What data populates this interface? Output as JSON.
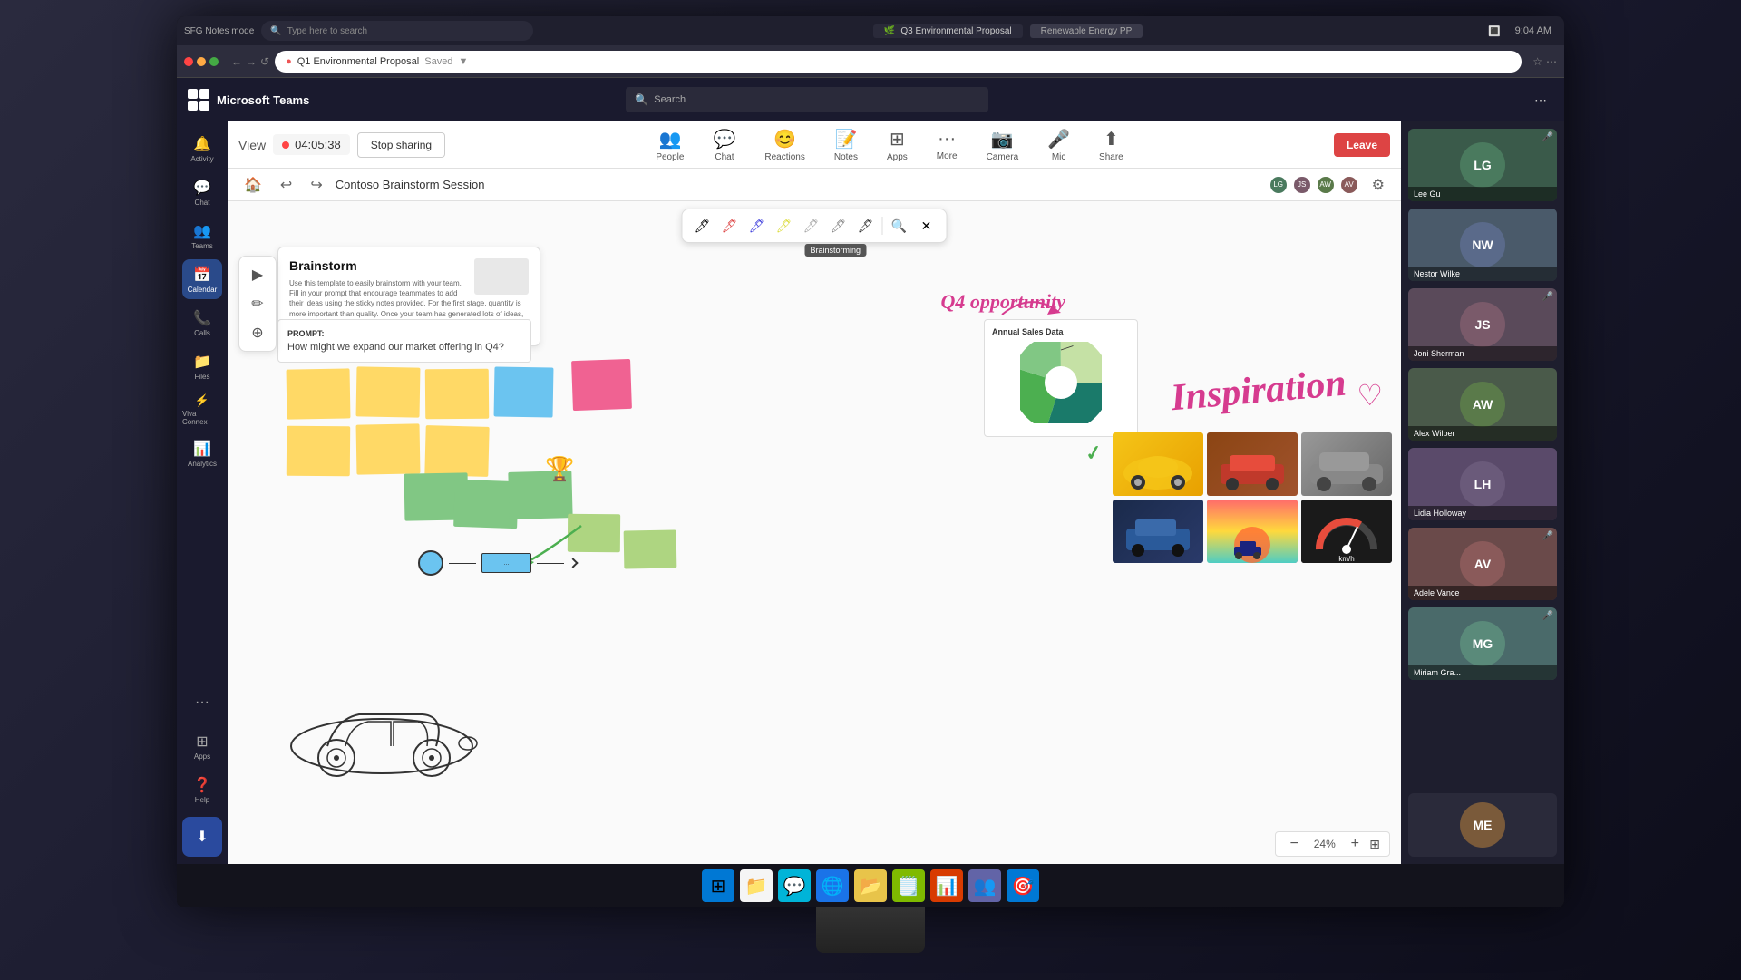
{
  "window": {
    "title": "SFG Notes mode",
    "search_placeholder": "Type here to search",
    "tab1": "Q3 Environmental Proposal",
    "tab2": "Renewable Energy PP"
  },
  "browser": {
    "title": "Q1 Environmental Proposal",
    "saved_label": "Saved",
    "close_label": "×",
    "min_label": "–",
    "max_label": "□"
  },
  "teams": {
    "app_title": "Microsoft Teams",
    "search_placeholder": "Search"
  },
  "meeting": {
    "timer": "04:05:38",
    "stop_sharing": "Stop sharing",
    "whiteboard_title": "Contoso Brainstorm Session",
    "zoom_level": "24%"
  },
  "toolbar_buttons": {
    "people": "People",
    "chat": "Chat",
    "reactions": "Reactions",
    "notes": "Notes",
    "apps": "Apps",
    "more": "More",
    "camera": "Camera",
    "mic": "Mic",
    "share": "Share",
    "leave": "Leave"
  },
  "sidebar": {
    "items": [
      {
        "label": "Activity",
        "icon": "🔔"
      },
      {
        "label": "Chat",
        "icon": "💬"
      },
      {
        "label": "Teams",
        "icon": "👥"
      },
      {
        "label": "Calendar",
        "icon": "📅"
      },
      {
        "label": "Calls",
        "icon": "📞"
      },
      {
        "label": "Files",
        "icon": "📁"
      },
      {
        "label": "Viva Connex",
        "icon": "⚡"
      },
      {
        "label": "Analytics",
        "icon": "📊"
      },
      {
        "label": "...",
        "icon": "···"
      },
      {
        "label": "Apps",
        "icon": "⊞"
      },
      {
        "label": "Help",
        "icon": "❓"
      }
    ]
  },
  "brainstorm": {
    "title": "Brainstorm",
    "description": "Use this template to easily brainstorm with your team. Fill in your prompt that encourage teammates to add their ideas using the sticky notes provided. For the first stage, quantity is more important than quality. Once your team has generated lots of ideas, take time to review and vote on the ideas you like best.",
    "prompt_label": "PROMPT:",
    "prompt_text": "How might we expand our market offering in Q4?"
  },
  "chart": {
    "title": "Annual Sales Data"
  },
  "annotations": {
    "q4": "Q4 opportunity",
    "inspiration": "Inspiration"
  },
  "participants": [
    {
      "name": "Lee Gu",
      "mic": true,
      "color": "#4a7a5e"
    },
    {
      "name": "Nestor Wilke",
      "mic": false,
      "color": "#5a6a8a"
    },
    {
      "name": "Joni Sherman",
      "mic": true,
      "color": "#7a5a6a"
    },
    {
      "name": "Alex Wilber",
      "mic": false,
      "color": "#5a7a4a"
    },
    {
      "name": "Lidia Holloway",
      "mic": false,
      "color": "#6a5a7a"
    },
    {
      "name": "Adele Vance",
      "mic": true,
      "color": "#8a5a5a"
    },
    {
      "name": "Miriam Gra...",
      "mic": true,
      "color": "#5a8a7a"
    }
  ],
  "zoom": {
    "level": "24%",
    "minus": "−",
    "plus": "+"
  },
  "taskbar": {
    "icons": [
      "⊞",
      "📁",
      "💬",
      "🌐",
      "📂",
      "🗒️",
      "📊",
      "🎯",
      "👥"
    ]
  }
}
